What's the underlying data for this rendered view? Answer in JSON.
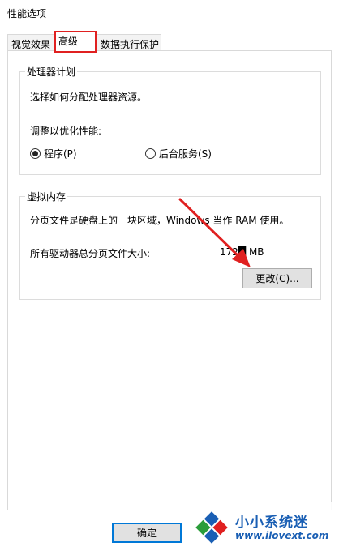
{
  "window": {
    "title": "性能选项"
  },
  "tabs": [
    {
      "label": "视觉效果"
    },
    {
      "label": "高级"
    },
    {
      "label": "数据执行保护"
    }
  ],
  "processor": {
    "group_label": "处理器计划",
    "description": "选择如何分配处理器资源。",
    "adjust_label": "调整以优化性能:",
    "options": [
      {
        "label": "程序(P)",
        "selected": true
      },
      {
        "label": "后台服务(S)",
        "selected": false
      }
    ]
  },
  "virtual_memory": {
    "group_label": "虚拟内存",
    "description": "分页文件是硬盘上的一块区域，Windows 当作 RAM 使用。",
    "total_label": "所有驱动器总分页文件大小:",
    "total_value": "172█ MB",
    "change_button": "更改(C)..."
  },
  "footer": {
    "ok_button": "确定"
  },
  "watermark": {
    "title": "小小系统迷",
    "url": "www.ilovext.com"
  },
  "colors": {
    "highlight": "#e02020",
    "accent": "#0078d7",
    "watermark": "#1a5fb4"
  }
}
